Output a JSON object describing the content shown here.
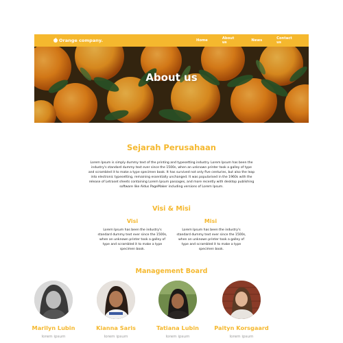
{
  "brand": {
    "name": "Orange company.",
    "logo_icon": "orange-icon"
  },
  "nav": {
    "items": [
      {
        "label": "Home"
      },
      {
        "label": "About us"
      },
      {
        "label": "News"
      },
      {
        "label": "Contact us"
      }
    ]
  },
  "hero": {
    "title": "About us"
  },
  "history": {
    "title": "Sejarah Perusahaan",
    "body": "Lorem Ipsum is simply dummy text of the printing and typesetting industry. Lorem Ipsum has been the industry's standard dummy text ever since the 1500s, when an unknown printer took a galley of type and scrambled it to make a type specimen book. It has survived not only five centuries, but also the leap into electronic typesetting, remaining essentially unchanged. It was popularised in the 1960s with the release of Letraset sheets containing Lorem Ipsum passages, and more recently with desktop publishing software like Aldus PageMaker including versions of Lorem Ipsum."
  },
  "vision_mission": {
    "title": "Visi & Misi",
    "vision": {
      "title": "Visi",
      "body": "Lorem Ipsum has been the industry's standard dummy text ever since the 1500s, when an unknown printer took a galley of type and scrambled it to make a type specimen book."
    },
    "mission": {
      "title": "Misi",
      "body": "Lorem Ipsum has been the industry's standard dummy text ever since the 1500s, when an unknown printer took a galley of type and scrambled it to make a type specimen book."
    }
  },
  "board": {
    "title": "Management Board",
    "members": [
      {
        "name": "Marilyn Lubin",
        "role": "lorem ipsum"
      },
      {
        "name": "Kianna Saris",
        "role": "lorem ipsum"
      },
      {
        "name": "Tatiana Lubin",
        "role": "lorem ipsum"
      },
      {
        "name": "Paityn Korsgaard",
        "role": "lorem ipsum"
      }
    ]
  },
  "colors": {
    "accent": "#f5b82e",
    "muted": "#999999",
    "text": "#222222"
  }
}
